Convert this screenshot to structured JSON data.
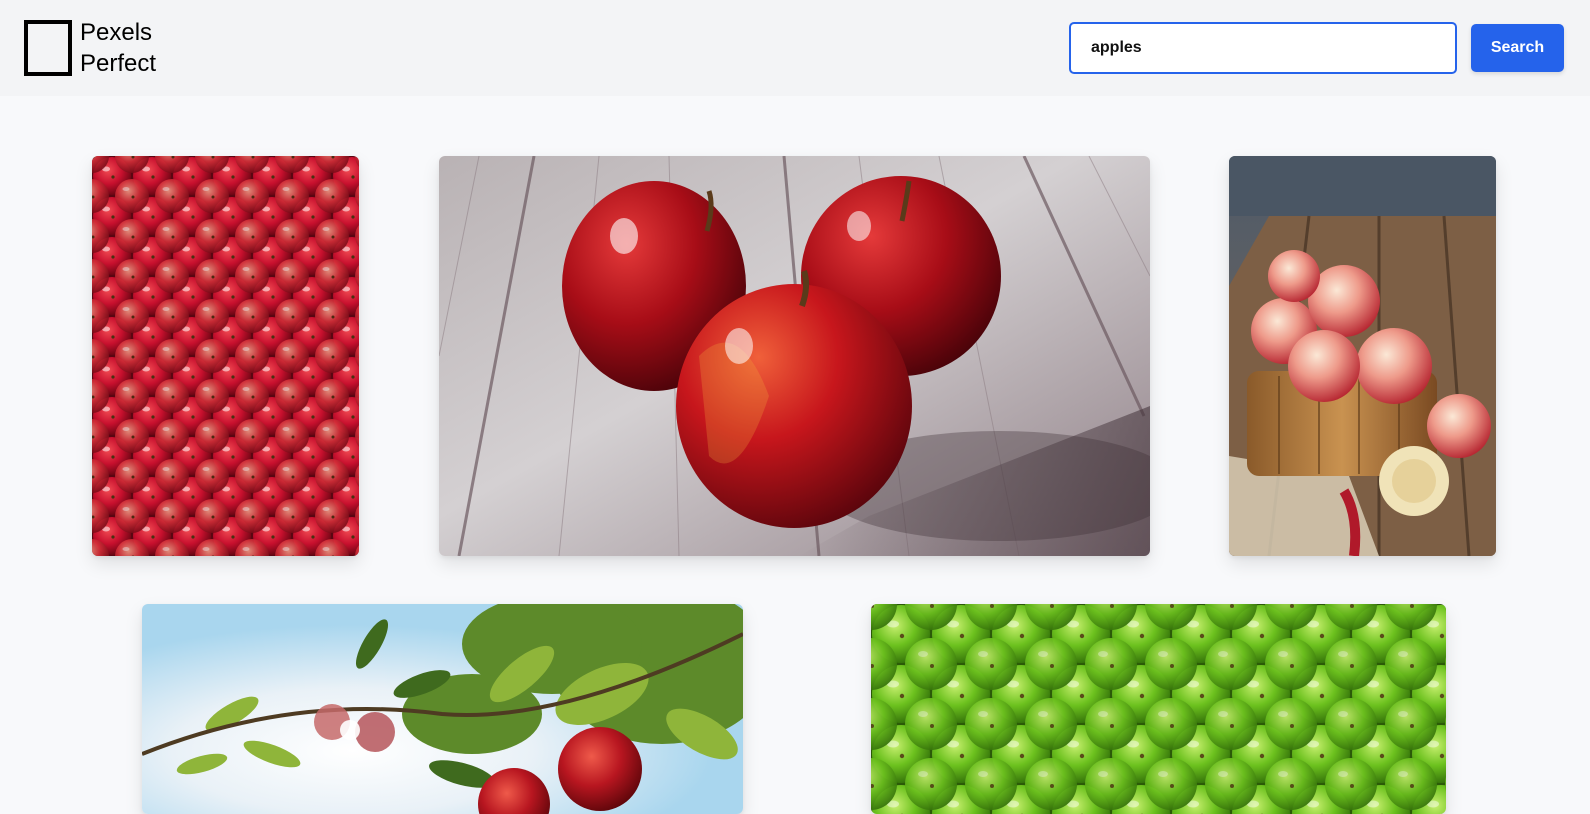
{
  "app": {
    "logo_line1": "Pexels",
    "logo_line2": "Perfect"
  },
  "search": {
    "value": "apples",
    "button_label": "Search"
  },
  "colors": {
    "accent": "#2563eb",
    "header_bg": "#f3f4f6",
    "page_bg": "#f8f9fb"
  },
  "gallery": {
    "images": [
      {
        "name": "red-apples-pile-image"
      },
      {
        "name": "three-red-apples-on-wood-image"
      },
      {
        "name": "apples-in-wooden-bucket-image"
      },
      {
        "name": "apples-on-tree-image"
      },
      {
        "name": "green-apples-pile-image"
      }
    ]
  }
}
